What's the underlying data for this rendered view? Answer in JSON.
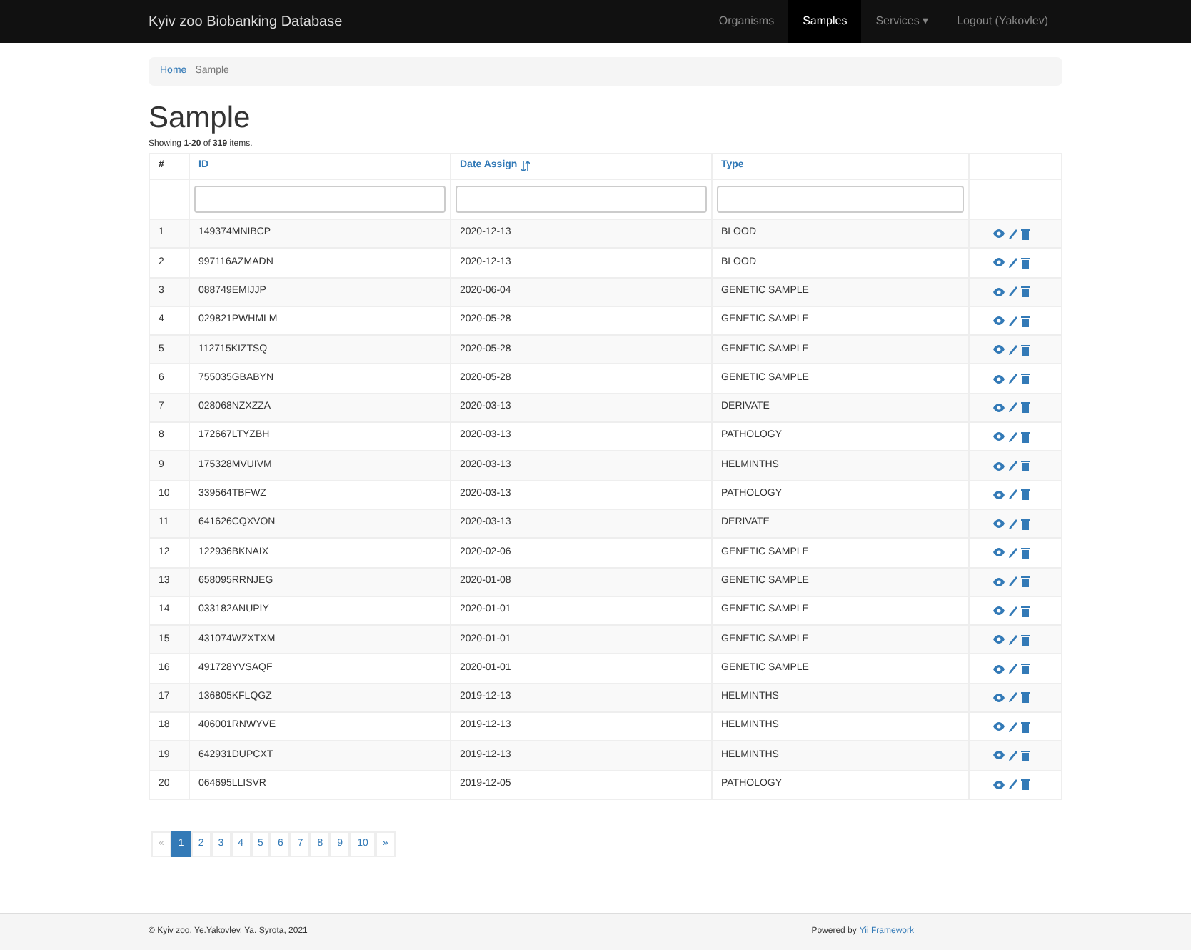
{
  "navbar": {
    "brand": "Kyiv zoo Biobanking Database",
    "items": [
      {
        "label": "Organisms",
        "selected": false
      },
      {
        "label": "Samples",
        "selected": true
      },
      {
        "label": "Services ▾",
        "selected": false
      },
      {
        "label": "Logout (Yakovlev)",
        "selected": false
      }
    ]
  },
  "breadcrumb": [
    {
      "label": "Home",
      "kind": "link"
    },
    {
      "label": "Sample",
      "kind": "current"
    }
  ],
  "title": "Sample",
  "summary": "Showing **1-20** of **319** items.",
  "table": {
    "columns": [
      {
        "label": "#",
        "kind": "plain"
      },
      {
        "label": "ID",
        "kind": "link"
      },
      {
        "label": "Date Assign",
        "kind": "sorted"
      },
      {
        "label": "Type",
        "kind": "link"
      }
    ],
    "rows": [
      [
        "1",
        "149374MNIBCP",
        "2020-12-13",
        "BLOOD"
      ],
      [
        "2",
        "997116AZMADN",
        "2020-12-13",
        "BLOOD"
      ],
      [
        "3",
        "088749EMIJJP",
        "2020-06-04",
        "GENETIC SAMPLE"
      ],
      [
        "4",
        "029821PWHMLM",
        "2020-05-28",
        "GENETIC SAMPLE"
      ],
      [
        "5",
        "112715KIZTSQ",
        "2020-05-28",
        "GENETIC SAMPLE"
      ],
      [
        "6",
        "755035GBABYN",
        "2020-05-28",
        "GENETIC SAMPLE"
      ],
      [
        "7",
        "028068NZXZZA",
        "2020-03-13",
        "DERIVATE"
      ],
      [
        "8",
        "172667LTYZBH",
        "2020-03-13",
        "PATHOLOGY"
      ],
      [
        "9",
        "175328MVUIVM",
        "2020-03-13",
        "HELMINTHS"
      ],
      [
        "10",
        "339564TBFWZ",
        "2020-03-13",
        "PATHOLOGY"
      ],
      [
        "11",
        "641626CQXVON",
        "2020-03-13",
        "DERIVATE"
      ],
      [
        "12",
        "122936BKNAIX",
        "2020-02-06",
        "GENETIC SAMPLE"
      ],
      [
        "13",
        "658095RRNJEG",
        "2020-01-08",
        "GENETIC SAMPLE"
      ],
      [
        "14",
        "033182ANUPIY",
        "2020-01-01",
        "GENETIC SAMPLE"
      ],
      [
        "15",
        "431074WZXTXM",
        "2020-01-01",
        "GENETIC SAMPLE"
      ],
      [
        "16",
        "491728YVSAQF",
        "2020-01-01",
        "GENETIC SAMPLE"
      ],
      [
        "17",
        "136805KFLQGZ",
        "2019-12-13",
        "HELMINTHS"
      ],
      [
        "18",
        "406001RNWYVE",
        "2019-12-13",
        "HELMINTHS"
      ],
      [
        "19",
        "642931DUPCXT",
        "2019-12-13",
        "HELMINTHS"
      ],
      [
        "20",
        "064695LLISVR",
        "2019-12-05",
        "PATHOLOGY"
      ]
    ]
  },
  "pagination": [
    {
      "label": "«",
      "selected": false,
      "disabled": true
    },
    {
      "label": "1",
      "selected": true,
      "disabled": false
    },
    {
      "label": "2",
      "selected": false,
      "disabled": false
    },
    {
      "label": "3",
      "selected": false,
      "disabled": false
    },
    {
      "label": "4",
      "selected": false,
      "disabled": false
    },
    {
      "label": "5",
      "selected": false,
      "disabled": false
    },
    {
      "label": "6",
      "selected": false,
      "disabled": false
    },
    {
      "label": "7",
      "selected": false,
      "disabled": false
    },
    {
      "label": "8",
      "selected": false,
      "disabled": false
    },
    {
      "label": "9",
      "selected": false,
      "disabled": false
    },
    {
      "label": "10",
      "selected": false,
      "disabled": false
    },
    {
      "label": "»",
      "selected": false,
      "disabled": false
    }
  ],
  "footer": {
    "copyright": "© Kyiv zoo, Ye.Yakovlev, Ya. Syrota, 2021",
    "powered": "Powered by",
    "framework": "Yii Framework"
  }
}
